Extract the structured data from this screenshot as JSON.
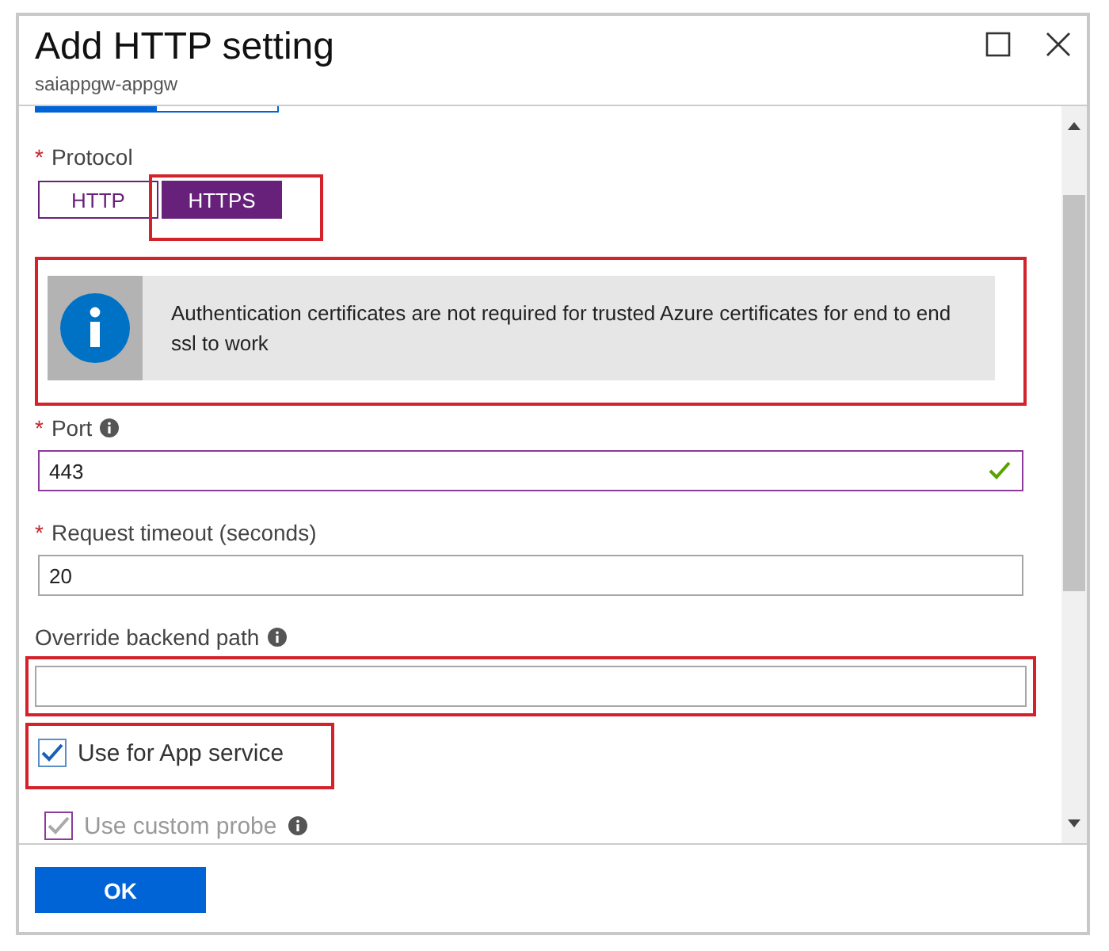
{
  "window": {
    "title": "Add HTTP setting",
    "subtitle": "saiappgw-appgw"
  },
  "protocol": {
    "label": "Protocol",
    "marker": "*",
    "options": [
      {
        "label": "HTTP",
        "selected": false,
        "highlighted": false
      },
      {
        "label": "HTTPS",
        "selected": true,
        "highlighted": true
      }
    ]
  },
  "info": {
    "text": "Authentication certificates are not required for trusted Azure certificates for end to end ssl to work",
    "highlighted": true
  },
  "fields": [
    {
      "label": "Port",
      "marker": "*",
      "info": true,
      "value": "443",
      "valid": true,
      "highlighted": false
    },
    {
      "label": "Request timeout (seconds)",
      "marker": "*",
      "info": false,
      "value": "20",
      "valid": false,
      "highlighted": false
    },
    {
      "label": "Override backend path",
      "info": true,
      "valid": false,
      "highlighted": true
    }
  ],
  "checkboxes": [
    {
      "label": "Use for App service",
      "checked": true,
      "disabled": false,
      "info": false,
      "highlighted": true
    },
    {
      "label": "Use custom probe",
      "checked": true,
      "disabled": true,
      "info": true,
      "highlighted": false
    }
  ],
  "buttons": [
    {
      "label": "OK"
    }
  ]
}
